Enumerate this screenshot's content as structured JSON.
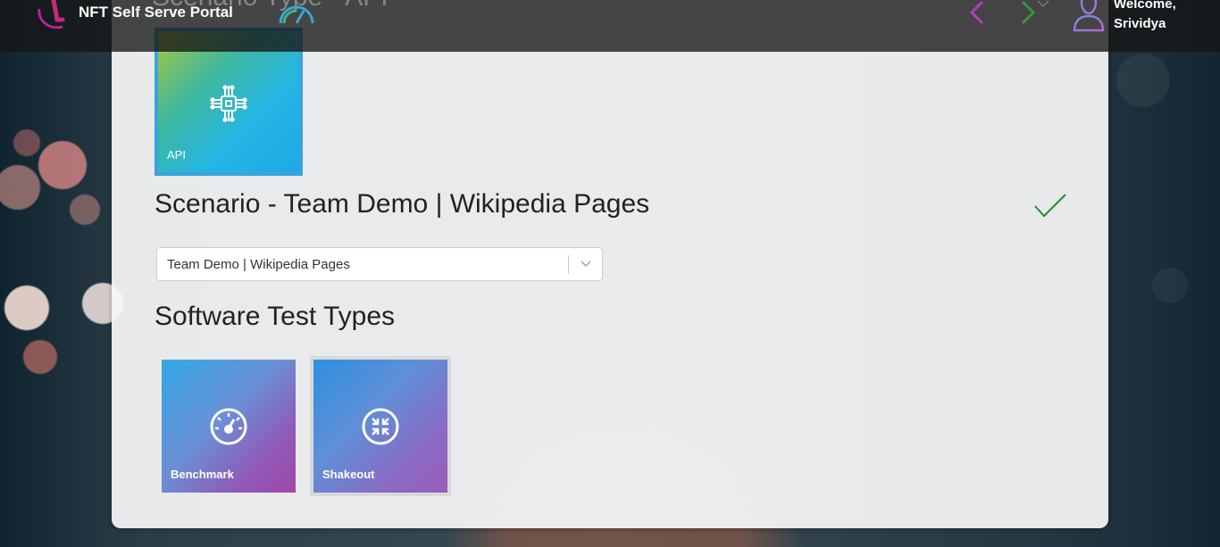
{
  "header": {
    "brand": "NFT Self Serve Portal",
    "ghost_title": "Scenario Type - API",
    "welcome_line1": "Welcome,",
    "welcome_line2": "Srividya"
  },
  "selected_type_tile": {
    "label": "API",
    "icon": "circuit-chip-icon"
  },
  "scenario": {
    "title": "Scenario - Team Demo | Wikipedia Pages",
    "status_icon": "checkmark-icon",
    "status_color": "#2e8b2e"
  },
  "scenario_select": {
    "value": "Team Demo | Wikipedia Pages"
  },
  "test_types": {
    "heading": "Software Test Types",
    "items": [
      {
        "label": "Benchmark",
        "icon": "speedometer-icon"
      },
      {
        "label": "Shakeout",
        "icon": "shakeout-arrows-icon"
      }
    ]
  },
  "colors": {
    "nav_prev": "#b23cc0",
    "nav_next": "#2e9a3a",
    "header_bg": "#161616"
  }
}
